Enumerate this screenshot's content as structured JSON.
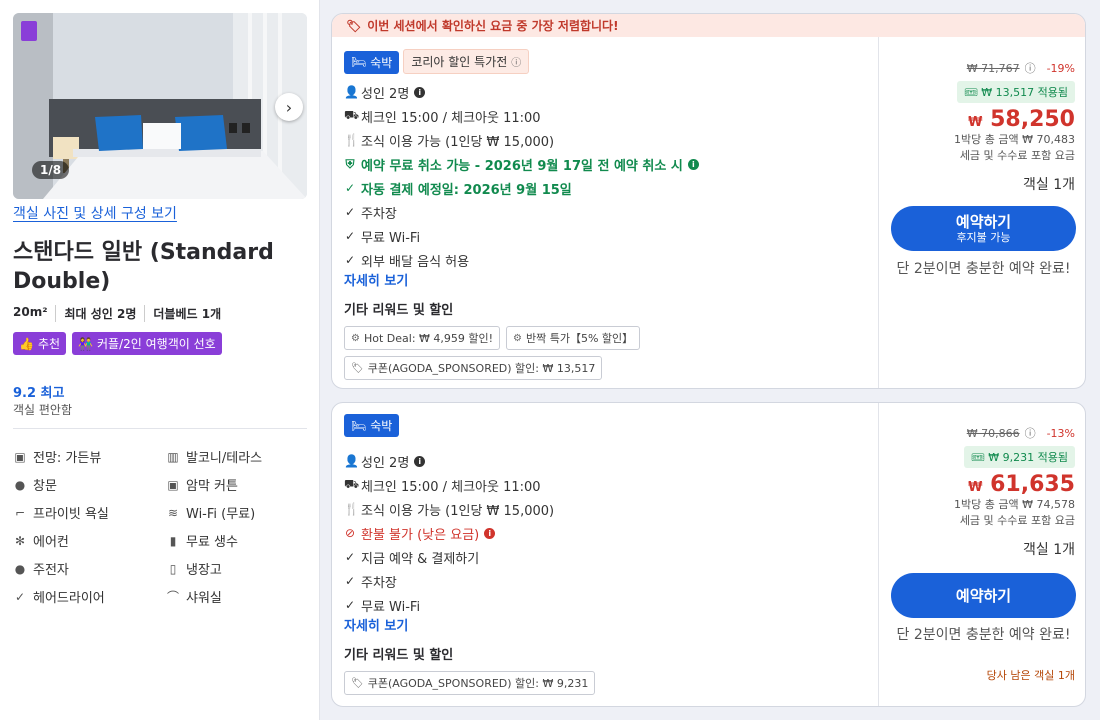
{
  "left": {
    "photo_counter": "1/8",
    "photo_link": "객실 사진 및 상세 구성 보기",
    "title": "스탠다드 일반 (Standard Double)",
    "specs": [
      "20m²",
      "최대 성인 2명",
      "더블베드 1개"
    ],
    "tags": [
      {
        "icon": "thumbs-up-icon",
        "label": "추천"
      },
      {
        "icon": "couple-icon",
        "label": "커플/2인 여행객이 선호"
      }
    ],
    "rating": "9.2 최고",
    "rating_sub": "객실 편안함",
    "amenities": [
      {
        "icon": "view-icon",
        "label": "전망: 가든뷰"
      },
      {
        "icon": "balcony-icon",
        "label": "발코니/테라스"
      },
      {
        "icon": "window-icon",
        "label": "창문"
      },
      {
        "icon": "blackout-icon",
        "label": "암막 커튼"
      },
      {
        "icon": "bath-icon",
        "label": "프라이빗 욕실"
      },
      {
        "icon": "wifi-icon",
        "label": "Wi-Fi (무료)"
      },
      {
        "icon": "ac-icon",
        "label": "에어컨"
      },
      {
        "icon": "water-icon",
        "label": "무료 생수"
      },
      {
        "icon": "kettle-icon",
        "label": "주전자"
      },
      {
        "icon": "fridge-icon",
        "label": "냉장고"
      },
      {
        "icon": "hairdryer-icon",
        "label": "헤어드라이어"
      },
      {
        "icon": "shower-icon",
        "label": "샤워실"
      }
    ]
  },
  "offers": [
    {
      "banner": "이번 세션에서 확인하신 요금 중 가장 저렴합니다!",
      "stay_label": "숙박",
      "promo_label": "코리아 할인 특가전",
      "features": [
        {
          "icon": "person-icon",
          "label": "성인 2명",
          "style": "normal",
          "info": true
        },
        {
          "icon": "checkin-icon",
          "label": "체크인 15:00 / 체크아웃 11:00",
          "style": "normal"
        },
        {
          "icon": "utensils-icon",
          "label": "조식 이용 가능 (1인당 ₩ 15,000)",
          "style": "normal"
        },
        {
          "icon": "shield-check-icon",
          "label": "예약 무료 취소 가능 - 2026년 9월 17일 전 예약 취소 시",
          "style": "green",
          "info": true
        },
        {
          "icon": "check-icon",
          "label": "자동 결제 예정일: 2026년 9월 15일",
          "style": "green"
        },
        {
          "icon": "check-icon",
          "label": "주차장",
          "style": "normal"
        },
        {
          "icon": "check-icon",
          "label": "무료 Wi-Fi",
          "style": "normal"
        },
        {
          "icon": "check-icon",
          "label": "외부 배달 음식 허용",
          "style": "normal"
        }
      ],
      "more_link": "자세히 보기",
      "rewards_title": "기타 리워드 및 할인",
      "chips": [
        {
          "icon": "gear-icon",
          "label": "Hot Deal: ₩ 4,959 할인!"
        },
        {
          "icon": "gear-icon",
          "label": "반짝 특가【5% 할인】"
        },
        {
          "icon": "tag-icon",
          "label": "쿠폰(AGODA_SPONSORED) 할인: ₩ 13,517"
        }
      ],
      "old_price": "₩ 71,767",
      "discount_pct": "-19%",
      "coupon_applied": "₩ 13,517 적용됨",
      "currency": "₩",
      "price": "58,250",
      "total_line": "1박당 총 금액 ₩ 70,483",
      "tax_line": "세금 및 수수료 포함 요금",
      "room_count": "객실 1개",
      "book_label": "예약하기",
      "book_sub": "후지불 가능",
      "quick_text": "단 2분이면 충분한 예약 완료!",
      "rooms_left": ""
    },
    {
      "banner": "",
      "stay_label": "숙박",
      "promo_label": "",
      "features": [
        {
          "icon": "person-icon",
          "label": "성인 2명",
          "style": "normal",
          "info": true
        },
        {
          "icon": "checkin-icon",
          "label": "체크인 15:00 / 체크아웃 11:00",
          "style": "normal"
        },
        {
          "icon": "utensils-icon",
          "label": "조식 이용 가능 (1인당 ₩ 15,000)",
          "style": "normal"
        },
        {
          "icon": "no-entry-icon",
          "label": "환불 불가 (낮은 요금)",
          "style": "red",
          "info": true
        },
        {
          "icon": "check-icon",
          "label": "지금 예약 & 결제하기",
          "style": "normal"
        },
        {
          "icon": "check-icon",
          "label": "주차장",
          "style": "normal"
        },
        {
          "icon": "check-icon",
          "label": "무료 Wi-Fi",
          "style": "normal"
        }
      ],
      "more_link": "자세히 보기",
      "rewards_title": "기타 리워드 및 할인",
      "chips": [
        {
          "icon": "tag-icon",
          "label": "쿠폰(AGODA_SPONSORED) 할인: ₩ 9,231"
        }
      ],
      "old_price": "₩ 70,866",
      "discount_pct": "-13%",
      "coupon_applied": "₩ 9,231 적용됨",
      "currency": "₩",
      "price": "61,635",
      "total_line": "1박당 총 금액 ₩ 74,578",
      "tax_line": "세금 및 수수료 포함 요금",
      "room_count": "객실 1개",
      "book_label": "예약하기",
      "book_sub": "",
      "quick_text": "단 2분이면 충분한 예약 완료!",
      "rooms_left": "당사 남은 객실 1개"
    }
  ]
}
